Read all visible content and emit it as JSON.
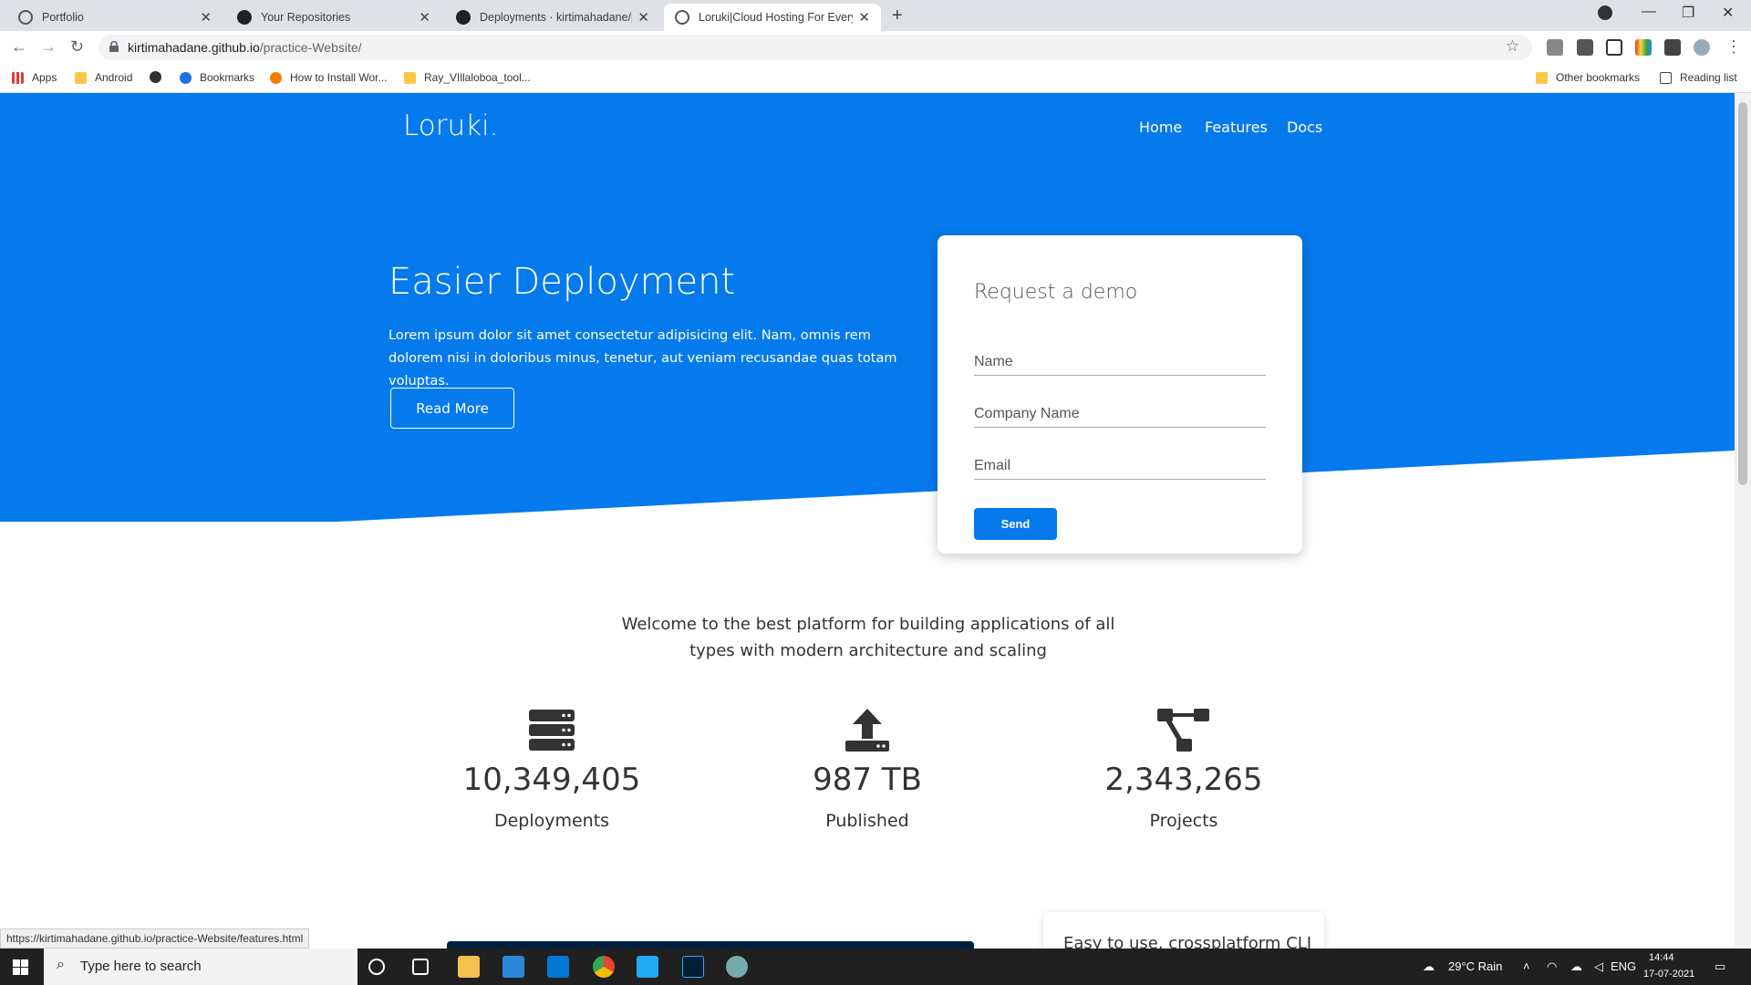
{
  "browser": {
    "tabs": [
      {
        "title": "Portfolio"
      },
      {
        "title": "Your Repositories"
      },
      {
        "title": "Deployments · kirtimahadane/pr"
      },
      {
        "title": "Loruki|Cloud Hosting For Everyon"
      }
    ],
    "url_host": "kirtimahadane.github.io",
    "url_path": "/practice-Website/",
    "bookmarks": [
      "Apps",
      "Android",
      "Bookmarks",
      "How to Install Wor...",
      "Ray_VIllaloboa_tool..."
    ],
    "other_bookmarks": "Other bookmarks",
    "reading_list": "Reading list",
    "status_link": "https://kirtimahadane.github.io/practice-Website/features.html"
  },
  "site": {
    "logo": "Loruki.",
    "nav": [
      "Home",
      "Features",
      "Docs"
    ],
    "hero": {
      "title": "Easier Deployment",
      "text": "Lorem ipsum dolor sit amet consectetur adipisicing elit. Nam, omnis rem dolorem nisi in doloribus minus, tenetur, aut veniam recusandae quas totam voluptas.",
      "button": "Read More"
    },
    "demo_form": {
      "title": "Request a demo",
      "name_placeholder": "Name",
      "company_placeholder": "Company Name",
      "email_placeholder": "Email",
      "send": "Send"
    },
    "welcome": "Welcome to the best platform for building applications of all types with modern architecture and scaling",
    "stats": [
      {
        "icon": "server-icon",
        "number": "10,349,405",
        "label": "Deployments"
      },
      {
        "icon": "upload-icon",
        "number": "987 TB",
        "label": "Published"
      },
      {
        "icon": "project-diagram-icon",
        "number": "2,343,265",
        "label": "Projects"
      }
    ],
    "bottom_card_text": "Easy to use, crossplatform CLI",
    "colors": {
      "primary": "#047aed",
      "dark": "#002240"
    }
  },
  "taskbar": {
    "search_placeholder": "Type here to search",
    "weather": "29°C  Rain",
    "lang": "ENG",
    "time": "14:44",
    "date": "17-07-2021"
  }
}
